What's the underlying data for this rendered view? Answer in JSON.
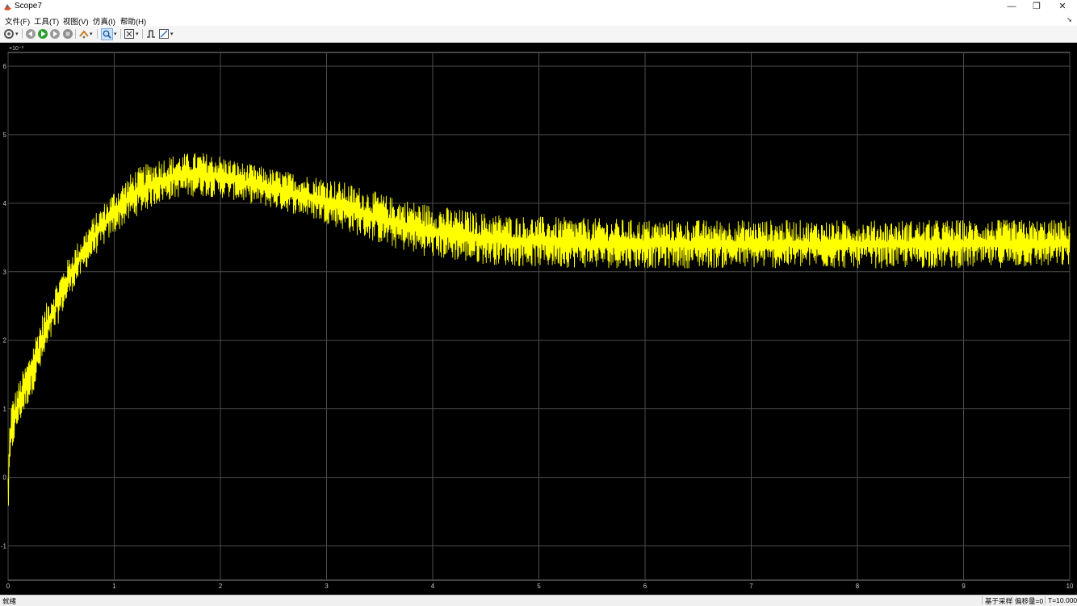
{
  "window": {
    "title": "Scope7",
    "minimize_glyph": "—",
    "restore_glyph": "❐",
    "close_glyph": "✕"
  },
  "menu": {
    "items": [
      "文件(F)",
      "工具(T)",
      "视图(V)",
      "仿真(I)",
      "帮助(H)"
    ]
  },
  "toolbar": {
    "icons": [
      "settings-icon",
      "step-back-icon",
      "run-icon",
      "step-forward-icon",
      "stop-icon",
      "highlight-icon",
      "zoom-icon",
      "fit-to-view-icon",
      "triggers-icon",
      "measurements-icon"
    ]
  },
  "statusbar": {
    "left": "就绪",
    "sampling": "基于采样",
    "offset": "偏移量=0",
    "time": "T=10.000"
  },
  "chart_data": {
    "type": "line",
    "title": "",
    "xlabel": "",
    "ylabel": "",
    "y_exponent": "×10⁻³",
    "xlim": [
      0,
      10
    ],
    "ylim": [
      -1.5,
      6.2
    ],
    "xticks": [
      0,
      1,
      2,
      3,
      4,
      5,
      6,
      7,
      8,
      9,
      10
    ],
    "yticks": [
      -1,
      0,
      1,
      2,
      3,
      4,
      5,
      6
    ],
    "grid": true,
    "background": "#000000",
    "grid_color": "#4d4d4d",
    "tick_color": "#c8c8c8",
    "series": [
      {
        "color": "#ffff00",
        "envelope": {
          "x": [
            0,
            0.02,
            0.05,
            0.1,
            0.2,
            0.3,
            0.4,
            0.5,
            0.6,
            0.8,
            1.0,
            1.2,
            1.4,
            1.6,
            1.8,
            2.0,
            2.2,
            2.5,
            2.8,
            3.0,
            3.3,
            3.6,
            4.0,
            4.4,
            4.8,
            5.2,
            5.6,
            6.0,
            7.0,
            8.0,
            9.0,
            10.0
          ],
          "upper": [
            0.1,
            1.1,
            1.2,
            1.4,
            1.8,
            2.3,
            2.7,
            3.0,
            3.3,
            3.8,
            4.2,
            4.5,
            4.65,
            4.72,
            4.75,
            4.7,
            4.6,
            4.5,
            4.42,
            4.38,
            4.25,
            4.1,
            3.98,
            3.88,
            3.82,
            3.8,
            3.78,
            3.76,
            3.76,
            3.75,
            3.76,
            3.76
          ],
          "lower": [
            -0.65,
            0.0,
            0.45,
            0.75,
            1.1,
            1.5,
            1.95,
            2.35,
            2.7,
            3.2,
            3.55,
            3.8,
            3.98,
            4.08,
            4.1,
            4.08,
            4.02,
            3.92,
            3.8,
            3.7,
            3.52,
            3.35,
            3.2,
            3.12,
            3.08,
            3.06,
            3.05,
            3.05,
            3.05,
            3.05,
            3.05,
            3.07
          ]
        }
      }
    ]
  }
}
